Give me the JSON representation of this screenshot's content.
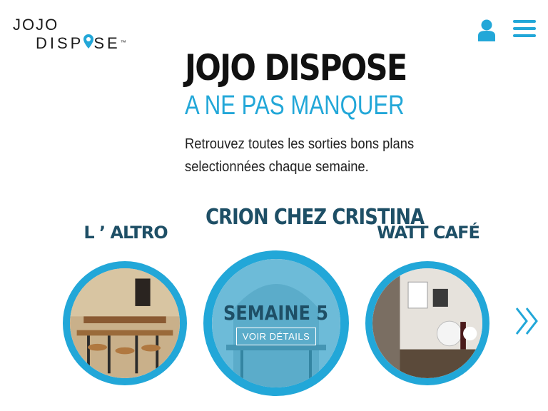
{
  "brand": {
    "logo_line1": "JOJO",
    "logo_line2_a": "DISP",
    "logo_line2_b": "SE",
    "logo_tm": "™"
  },
  "hero": {
    "title": "JOJO DISPOSE",
    "subtitle": "A NE PAS MANQUER",
    "description": "Retrouvez toutes les sorties bons plans selectionnées chaque semaine."
  },
  "cards": [
    {
      "name": "L ’ ALTRO"
    },
    {
      "name": "CRION CHEZ CRISTINA",
      "week": "SEMAINE 5",
      "details_label": "VOIR DÉTAILS"
    },
    {
      "name": "WATT CAFÉ"
    }
  ],
  "icons": {
    "user": "user-icon",
    "menu": "hamburger-menu-icon",
    "next": "double-chevron-right-icon",
    "pin": "map-pin-icon"
  },
  "colors": {
    "accent": "#22a7d8",
    "card_title": "#1e4f66",
    "text": "#111111"
  }
}
